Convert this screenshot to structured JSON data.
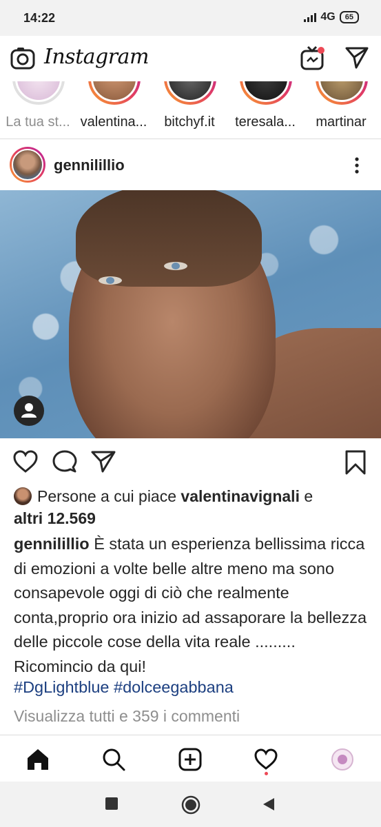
{
  "status_bar": {
    "time": "14:22",
    "network": "4G",
    "battery": "65"
  },
  "app": {
    "title": "Instagram"
  },
  "stories": [
    {
      "label": "La tua st..."
    },
    {
      "label": "valentina..."
    },
    {
      "label": "bitchyf.it"
    },
    {
      "label": "teresala..."
    },
    {
      "label": "martinar"
    }
  ],
  "post": {
    "username": "gennilillio",
    "likes": {
      "prefix": "Persone a cui piace",
      "liker": "valentinavignali",
      "conj": "e",
      "others": "altri 12.569"
    },
    "caption": {
      "author": "gennilillio",
      "text": "È stata un esperienza bellissima ricca di emozioni a volte belle altre meno ma sono consapevole oggi di ciò che realmente conta,proprio ora inizio ad assaporare la bellezza delle piccole cose della vita reale ......... Ricomincio da qui!"
    },
    "hashtags": "#DgLightblue #dolceegabbana",
    "view_comments": "Visualizza tutti e 359 i commenti"
  },
  "colors": {
    "accent_gradient_start": "#f9a12e",
    "accent_gradient_end": "#b8209e",
    "notification": "#ed4956",
    "hashtag": "#1c3f80"
  },
  "icons": {
    "appbar": [
      "camera-icon",
      "igtv-icon",
      "direct-message-icon"
    ],
    "actions": [
      "heart-icon",
      "comment-icon",
      "share-icon",
      "bookmark-icon"
    ],
    "tabs": [
      "home-icon",
      "search-icon",
      "add-post-icon",
      "activity-icon",
      "profile-icon"
    ],
    "system_nav": [
      "recents-icon",
      "home-circle-icon",
      "back-icon"
    ]
  }
}
